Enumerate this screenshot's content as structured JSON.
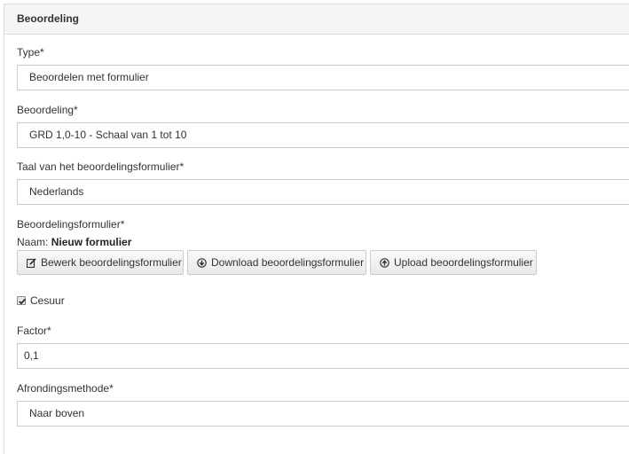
{
  "panel": {
    "title": "Beoordeling"
  },
  "type": {
    "label": "Type*",
    "value": "Beoordelen met formulier"
  },
  "beoordeling": {
    "label": "Beoordeling*",
    "value": "GRD 1,0-10 - Schaal van 1 tot 10"
  },
  "taal": {
    "label": "Taal van het beoordelingsformulier*",
    "value": "Nederlands"
  },
  "formulier": {
    "label": "Beoordelingsformulier*",
    "name_prefix": "Naam:",
    "name_value": "Nieuw formulier",
    "buttons": [
      {
        "label": "Bewerk beoordelingsformulier",
        "icon": "edit-icon"
      },
      {
        "label": "Download beoordelingsformulier",
        "icon": "download-circle-icon"
      },
      {
        "label": "Upload beoordelingsformulier",
        "icon": "upload-circle-icon"
      }
    ]
  },
  "cesuur": {
    "label": "Cesuur",
    "checked": true
  },
  "factor": {
    "label": "Factor*",
    "value": "0,1"
  },
  "afronding": {
    "label": "Afrondingsmethode*",
    "value": "Naar boven"
  }
}
